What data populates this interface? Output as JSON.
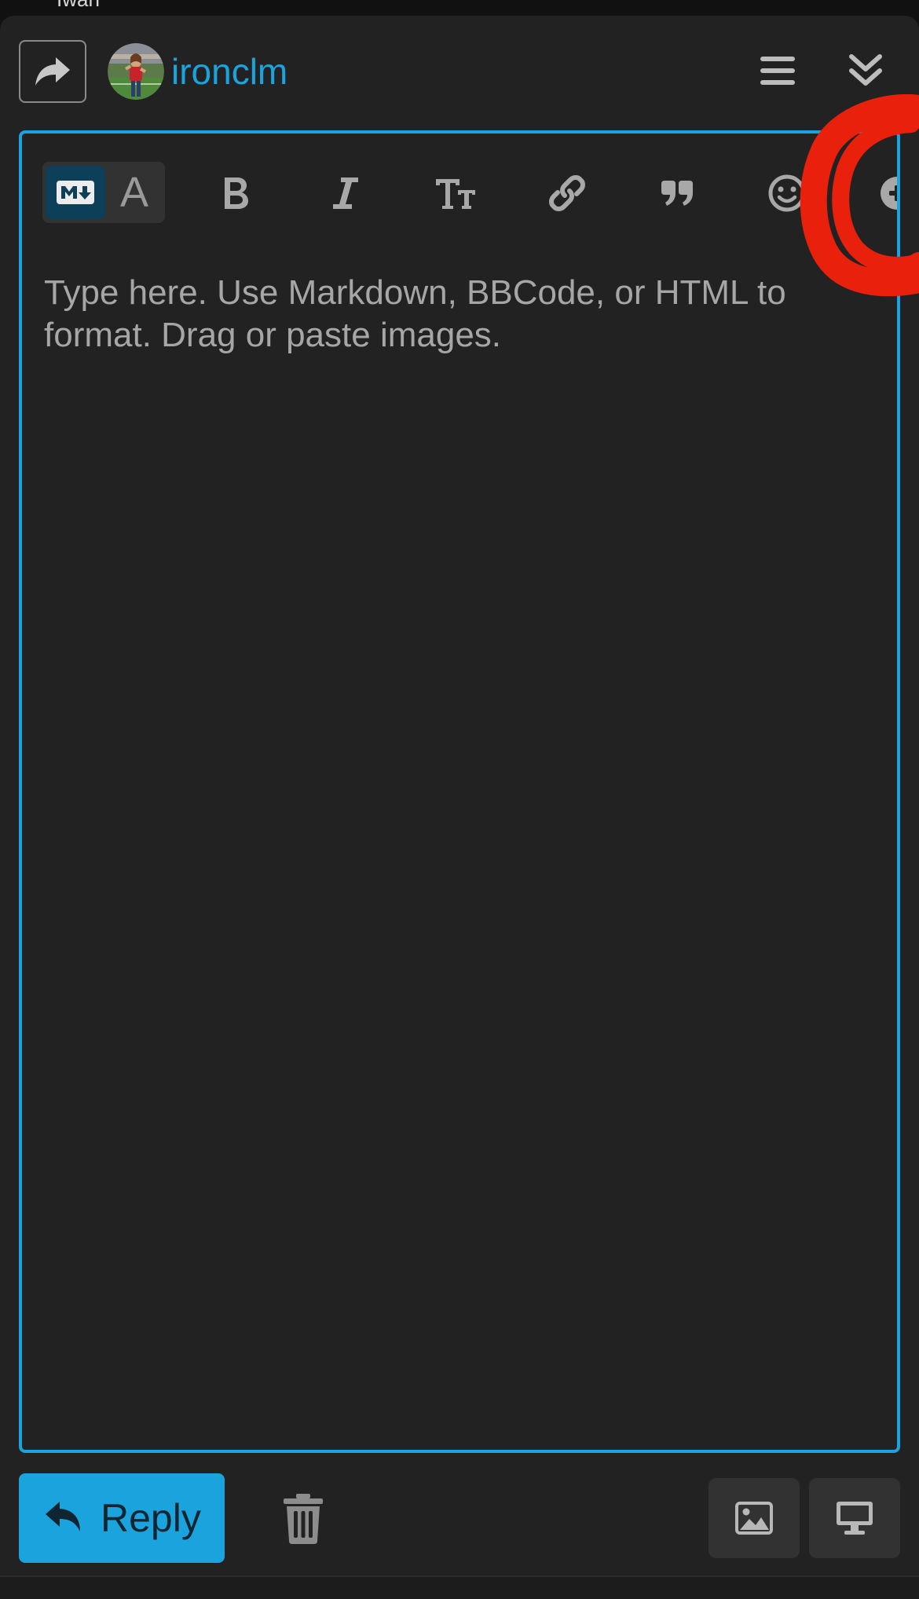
{
  "top_fragment": "Iwan",
  "composer": {
    "username": "ironclm",
    "icons": {
      "reply_to": "share-icon",
      "menu": "bars-icon",
      "collapse": "angles-down-icon"
    }
  },
  "toolbar": {
    "markdown_mode_icon": "markdown-icon",
    "rich_text_mode_label": "A",
    "buttons": [
      {
        "name": "bold",
        "icon": "bold-icon"
      },
      {
        "name": "italic",
        "icon": "italic-icon"
      },
      {
        "name": "heading",
        "icon": "text-height-icon"
      },
      {
        "name": "link",
        "icon": "link-icon"
      },
      {
        "name": "quote",
        "icon": "quote-icon"
      },
      {
        "name": "emoji",
        "icon": "smile-icon"
      },
      {
        "name": "more",
        "icon": "plus-circle-icon"
      }
    ]
  },
  "editor": {
    "placeholder": "Type here. Use Markdown, BBCode, or HTML to format. Drag or paste images.",
    "value": ""
  },
  "actions": {
    "reply_label": "Reply",
    "reply_icon": "reply-icon",
    "discard_icon": "trash-icon",
    "upload_icon": "image-icon",
    "preview_icon": "desktop-icon"
  },
  "colors": {
    "accent": "#1aa3dd",
    "background": "#222222",
    "annotation": "#e8200c"
  }
}
